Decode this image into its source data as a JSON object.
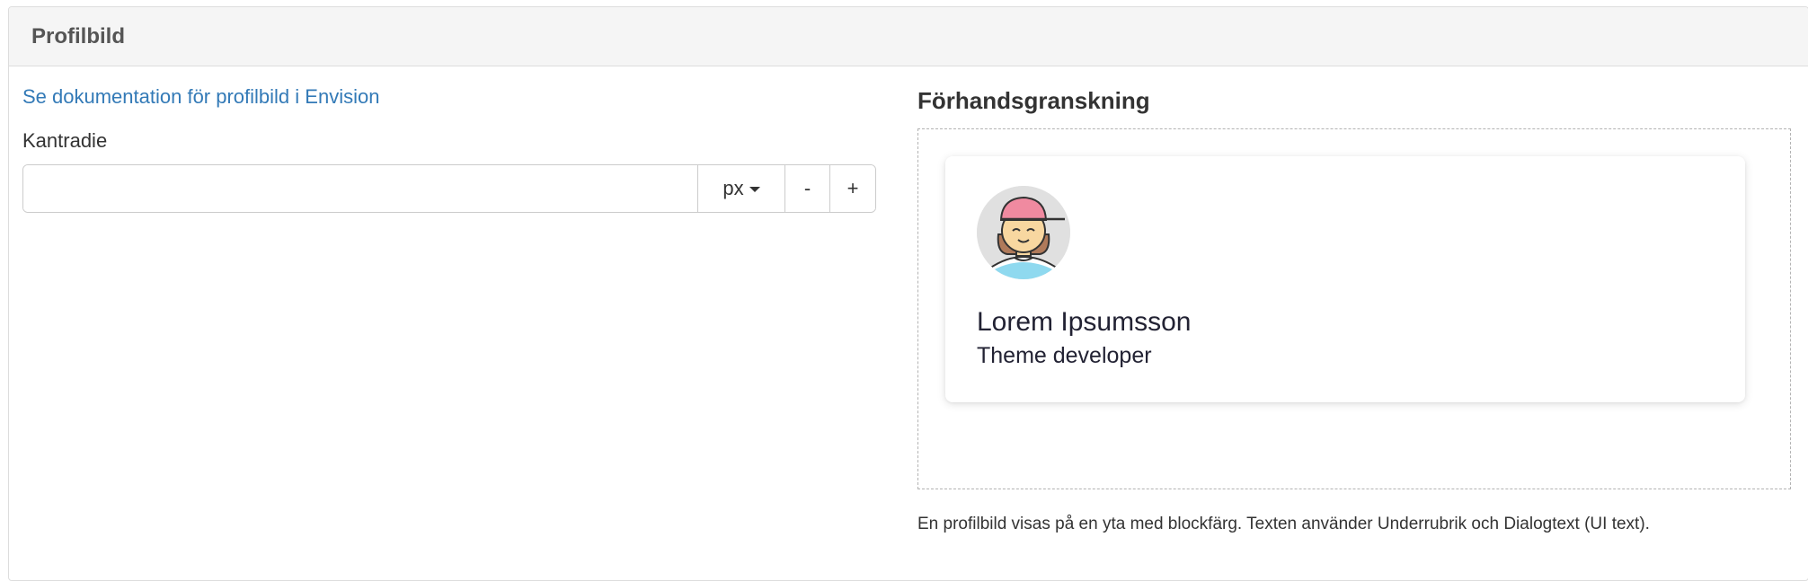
{
  "panel": {
    "title": "Profilbild"
  },
  "settings": {
    "doc_link": "Se dokumentation för profilbild i Envision",
    "border_radius_label": "Kantradie",
    "border_radius_value": "",
    "unit_label": "px",
    "decrement_label": "-",
    "increment_label": "+"
  },
  "preview": {
    "title": "Förhandsgranskning",
    "name": "Lorem Ipsumsson",
    "role": "Theme developer",
    "help_text": "En profilbild visas på en yta med blockfärg. Texten använder Underrubrik och Dialogtext (UI text)."
  },
  "colors": {
    "link": "#337ab7",
    "heading_bg": "#f5f5f5",
    "border": "#dddddd"
  },
  "icons": {
    "avatar": "person-avatar-icon",
    "unit_caret": "caret-down-icon"
  }
}
